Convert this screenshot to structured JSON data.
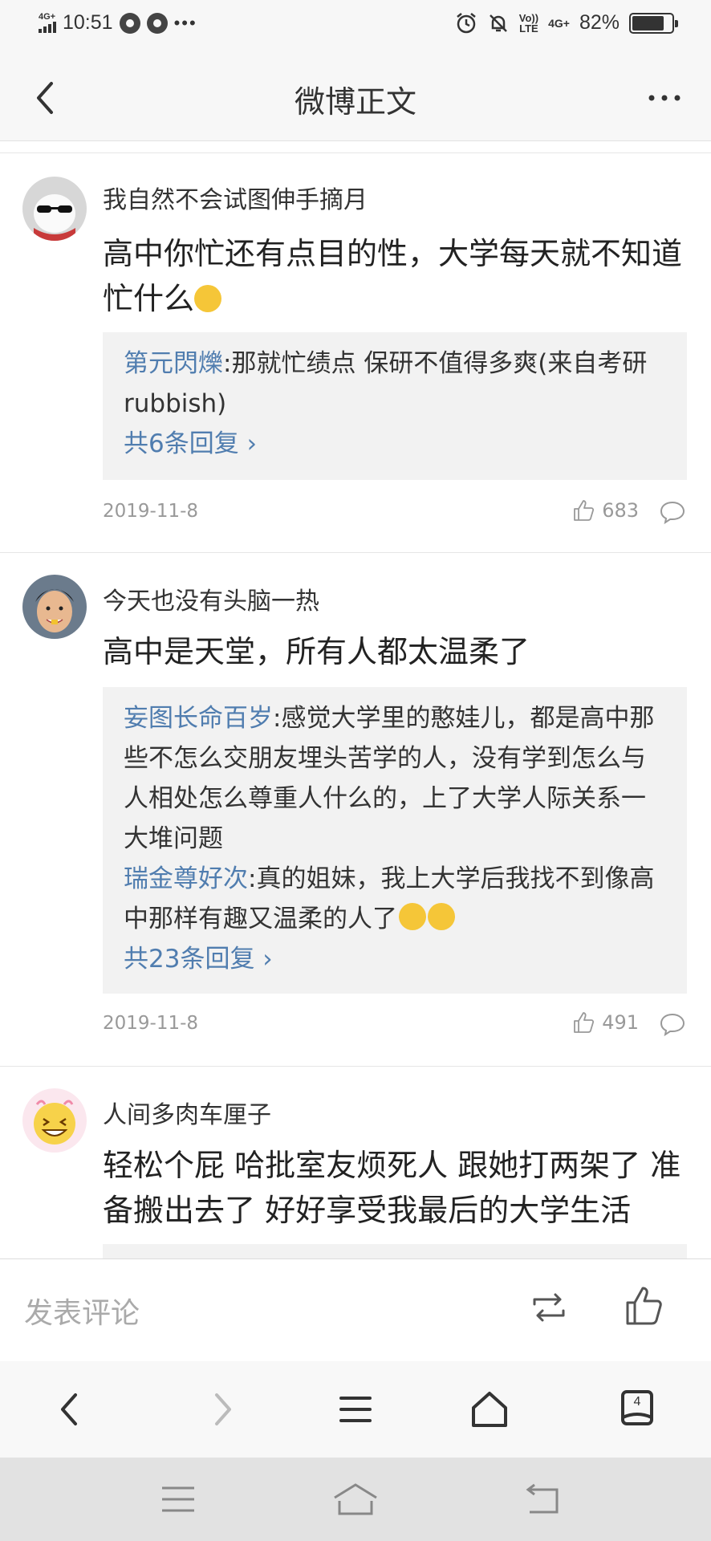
{
  "status_bar": {
    "network_left": "4G+",
    "time": "10:51",
    "network_right": "4G+",
    "volte_line1": "Vo))",
    "volte_line2": "LTE",
    "battery": "82%",
    "battery_level": 0.82
  },
  "nav": {
    "title": "微博正文"
  },
  "comments": [
    {
      "username": "我自然不会试图伸手摘月",
      "text": "高中你忙还有点目的性，大学每天就不知道忙什么",
      "replies": [
        {
          "name": "第元閃爍",
          "text": ":那就忙绩点 保研不值得多爽(来自考研rubbish)"
        }
      ],
      "more": "共6条回复",
      "date": "2019-11-8",
      "likes": "683"
    },
    {
      "username": "今天也没有头脑一热",
      "text": "高中是天堂，所有人都太温柔了",
      "replies": [
        {
          "name": "妄图长命百岁",
          "text": ":感觉大学里的憨娃儿，都是高中那些不怎么交朋友埋头苦学的人，没有学到怎么与人相处怎么尊重人什么的，上了大学人际关系一大堆问题"
        },
        {
          "name": "瑞金尊好次",
          "text": ":真的姐妹，我上大学后我找不到像高中那样有趣又温柔的人了"
        }
      ],
      "more": "共23条回复",
      "date": "2019-11-8",
      "likes": "491"
    },
    {
      "username": "人间多肉车厘子",
      "text": "轻松个屁 哈批室友烦死人 跟她打两架了 准备搬出去了 好好享受我最后的大学生活"
    }
  ],
  "comment_bar": {
    "placeholder": "发表评论"
  },
  "browser_bar": {
    "tab_count": "4"
  },
  "icons": {
    "back": "chevron-left-icon",
    "more": "more-dots-icon",
    "like": "thumbs-up-icon",
    "reply": "comment-bubble-icon",
    "repost": "repost-icon",
    "browser_back": "arrow-left-icon",
    "browser_forward": "arrow-right-icon",
    "menu": "menu-icon",
    "home": "home-icon",
    "tabs": "tabs-icon"
  },
  "colors": {
    "link": "#507daf",
    "text": "#222222",
    "meta": "#999999",
    "reply_bg": "#f2f2f2"
  }
}
